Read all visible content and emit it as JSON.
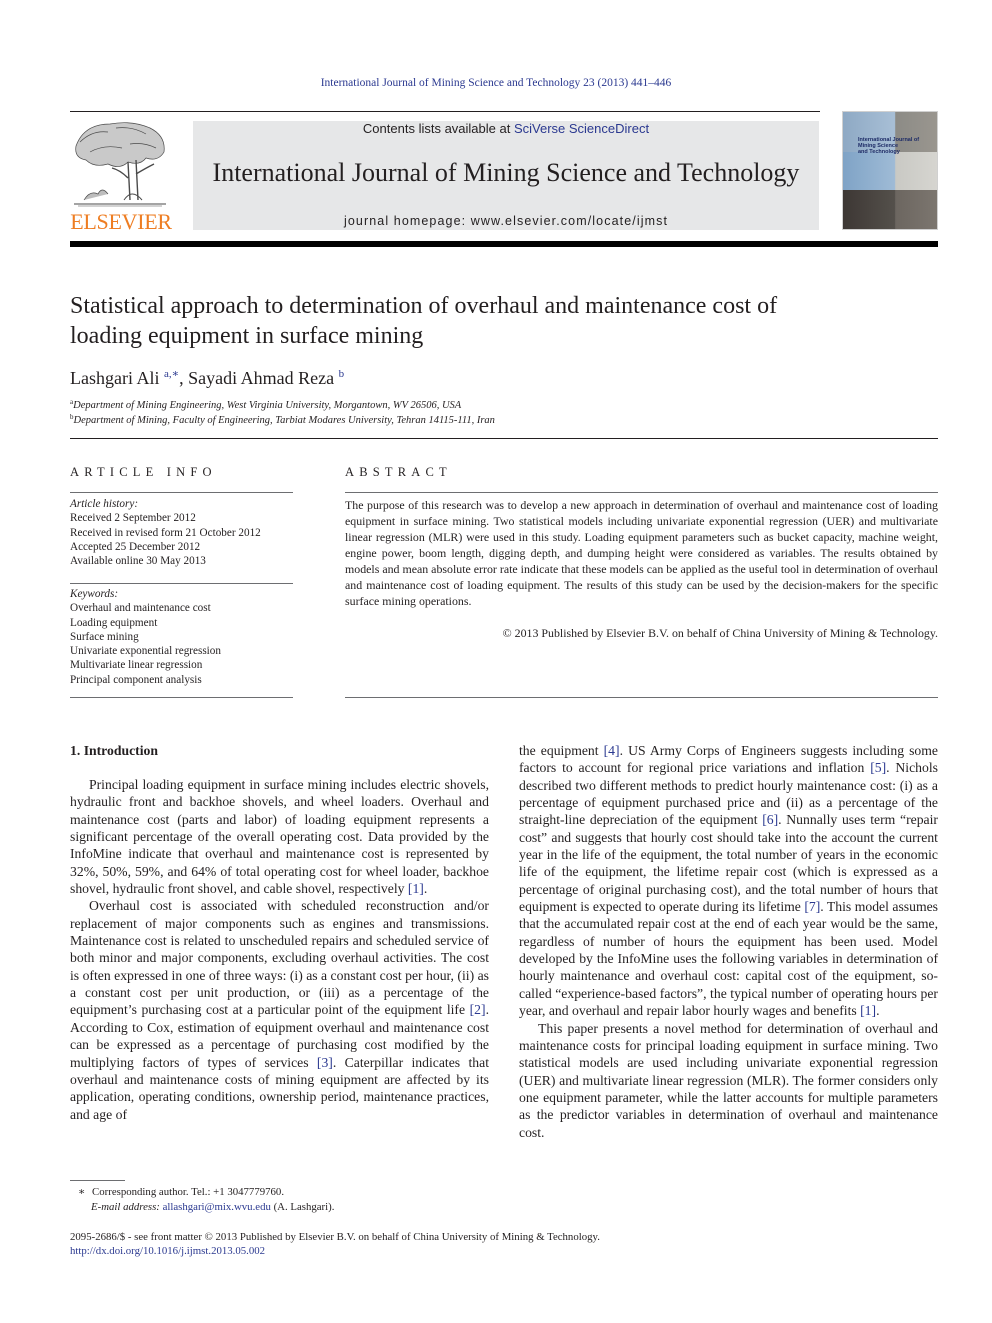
{
  "header": {
    "running_head": "International Journal of Mining Science and Technology 23 (2013) 441–446",
    "publisher_logo_text": "ELSEVIER",
    "contents_prefix": "Contents lists available at ",
    "contents_link": "SciVerse ScienceDirect",
    "journal_title": "International Journal of Mining Science and Technology",
    "homepage_line": "journal homepage: www.elsevier.com/locate/ijmst",
    "cover_title_lines": [
      "International Journal of",
      "Mining Science",
      "and Technology"
    ]
  },
  "article": {
    "title": "Statistical approach to determination of overhaul and maintenance cost of loading equipment in surface mining",
    "authors": [
      {
        "name": "Lashgari Ali",
        "marks": "a,∗",
        "separator": ", "
      },
      {
        "name": "Sayadi Ahmad Reza",
        "marks": "b",
        "separator": ""
      }
    ],
    "affiliations": [
      {
        "mark": "a",
        "text": "Department of Mining Engineering, West Virginia University, Morgantown, WV 26506, USA"
      },
      {
        "mark": "b",
        "text": "Department of Mining, Faculty of Engineering, Tarbiat Modares University, Tehran 14115-111, Iran"
      }
    ]
  },
  "article_info": {
    "heading": "ARTICLE INFO",
    "history_label": "Article history:",
    "history": [
      "Received 2 September 2012",
      "Received in revised form 21 October 2012",
      "Accepted 25 December 2012",
      "Available online 30 May 2013"
    ],
    "keywords_label": "Keywords:",
    "keywords": [
      "Overhaul and maintenance cost",
      "Loading equipment",
      "Surface mining",
      "Univariate exponential regression",
      "Multivariate linear regression",
      "Principal component analysis"
    ]
  },
  "abstract": {
    "heading": "ABSTRACT",
    "text": "The purpose of this research was to develop a new approach in determination of overhaul and maintenance cost of loading equipment in surface mining. Two statistical models including univariate exponential regression (UER) and multivariate linear regression (MLR) were used in this study. Loading equipment parameters such as bucket capacity, machine weight, engine power, boom length, digging depth, and dumping height were considered as variables. The results obtained by models and mean absolute error rate indicate that these models can be applied as the useful tool in determination of overhaul and maintenance cost of loading equipment. The results of this study can be used by the decision-makers for the specific surface mining operations.",
    "copyright": "© 2013 Published by Elsevier B.V. on behalf of China University of Mining & Technology."
  },
  "body": {
    "section_heading": "1. Introduction",
    "left_column": [
      {
        "indent": true,
        "segments": [
          {
            "t": "Principal loading equipment in surface mining includes electric shovels, hydraulic front and backhoe shovels, and wheel loaders. Overhaul and maintenance cost (parts and labor) of loading equipment represents a significant percentage of the overall operating cost. Data provided by the InfoMine indicate that overhaul and maintenance cost is represented by 32%, 50%, 59%, and 64% of total operating cost for wheel loader, backhoe shovel, hydraulic front shovel, and cable shovel, respectively "
          },
          {
            "ref": "[1]"
          },
          {
            "t": "."
          }
        ]
      },
      {
        "indent": true,
        "segments": [
          {
            "t": "Overhaul cost is associated with scheduled reconstruction and/or replacement of major components such as engines and transmissions. Maintenance cost is related to unscheduled repairs and scheduled service of both minor and major components, excluding overhaul activities. The cost is often expressed in one of three ways: (i) as a constant cost per hour, (ii) as a constant cost per unit production, or (iii) as a percentage of the equipment’s purchasing cost at a particular point of the equipment life "
          },
          {
            "ref": "[2]"
          },
          {
            "t": ". According to Cox, estimation of equipment overhaul and maintenance cost can be expressed as a percentage of purchasing cost modified by the multiplying factors of types of services "
          },
          {
            "ref": "[3]"
          },
          {
            "t": ". Caterpillar indicates that overhaul and maintenance costs of mining equipment are affected by its application, operating conditions, ownership period, maintenance practices, and age of"
          }
        ]
      }
    ],
    "right_column": [
      {
        "indent": false,
        "segments": [
          {
            "t": "the equipment "
          },
          {
            "ref": "[4]"
          },
          {
            "t": ". US Army Corps of Engineers suggests including some factors to account for regional price variations and inflation "
          },
          {
            "ref": "[5]"
          },
          {
            "t": ". Nichols described two different methods to predict hourly maintenance cost: (i) as a percentage of equipment purchased price and (ii) as a percentage of the straight-line depreciation of the equipment "
          },
          {
            "ref": "[6]"
          },
          {
            "t": ". Nunnally uses term “repair cost” and suggests that hourly cost should take into the account the current year in the life of the equipment, the total number of years in the economic life of the equipment, the lifetime repair cost (which is expressed as a percentage of original purchasing cost), and the total number of hours that equipment is expected to operate during its lifetime "
          },
          {
            "ref": "[7]"
          },
          {
            "t": ". This model assumes that the accumulated repair cost at the end of each year would be the same, regardless of number of hours the equipment has been used. Model developed by the InfoMine uses the following variables in determination of hourly maintenance and overhaul cost: capital cost of the equipment, so-called “experience-based factors”, the typical number of operating hours per year, and overhaul and repair labor hourly wages and benefits "
          },
          {
            "ref": "[1]"
          },
          {
            "t": "."
          }
        ]
      },
      {
        "indent": true,
        "segments": [
          {
            "t": "This paper presents a novel method for determination of overhaul and maintenance costs for principal loading equipment in surface mining. Two statistical models are used including univariate exponential regression (UER) and multivariate linear regression (MLR). The former considers only one equipment parameter, while the latter accounts for multiple parameters as the predictor variables in determination of overhaul and maintenance cost."
          }
        ]
      }
    ]
  },
  "footnotes": {
    "corresponding_mark": "∗",
    "corresponding_text": "Corresponding author. Tel.: +1 3047779760.",
    "email_label": "E-mail address:",
    "email": "allashgari@mix.wvu.edu",
    "email_suffix": " (A. Lashgari).",
    "issn_line": "2095-2686/$ - see front matter © 2013 Published by Elsevier B.V. on behalf of China University of Mining & Technology.",
    "doi": "http://dx.doi.org/10.1016/j.ijmst.2013.05.002"
  },
  "colors": {
    "link": "#2b3990",
    "elsevier_orange": "#ee7d22",
    "masthead_gray": "#e6e7e8"
  }
}
